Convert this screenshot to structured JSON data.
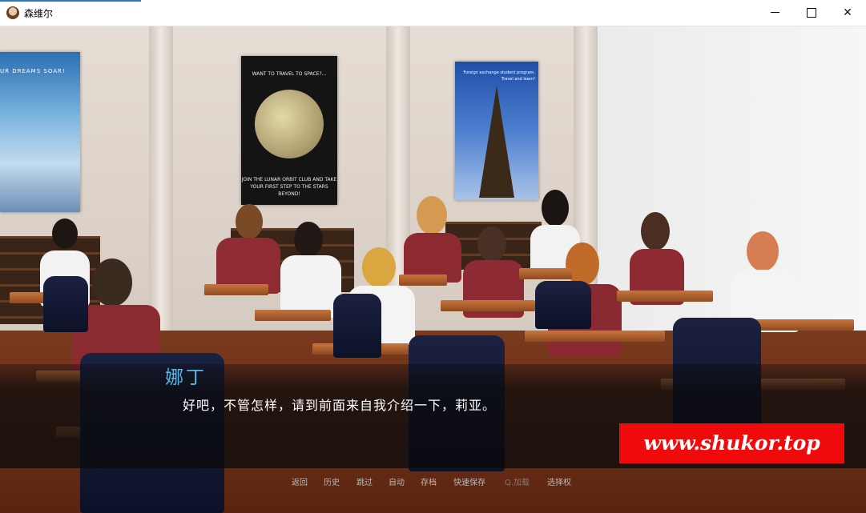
{
  "window": {
    "title": "森维尔",
    "icon": "portrait-icon",
    "controls": {
      "minimize": "minimize-icon",
      "maximize": "maximize-icon",
      "close": "✕"
    }
  },
  "scene": {
    "posters": [
      {
        "text": "UR DREAMS SOAR!"
      },
      {
        "top_text": "WANT TO TRAVEL TO SPACE?...",
        "bottom_text": "JOIN THE LUNAR ORBIT CLUB AND TAKE YOUR FIRST STEP TO THE STARS BEYOND!"
      },
      {
        "text": "Foreign exchange student program. Travel and learn!"
      }
    ]
  },
  "dialogue": {
    "speaker": "娜丁",
    "text": "好吧，不管怎样，请到前面来自我介绍一下，莉亚。"
  },
  "watermark": "www.shukor.top",
  "quick_menu": [
    {
      "label": "返回",
      "enabled": true
    },
    {
      "label": "历史",
      "enabled": true
    },
    {
      "label": "跳过",
      "enabled": true
    },
    {
      "label": "自动",
      "enabled": true
    },
    {
      "label": "存档",
      "enabled": true
    },
    {
      "label": "快速保存",
      "enabled": true
    },
    {
      "label": "Q.加载",
      "enabled": false
    },
    {
      "label": "选择权",
      "enabled": true
    }
  ],
  "colors": {
    "speaker": "#56b9e6",
    "watermark_bg": "#ef0b0b",
    "title_accent": "#2b78c6"
  }
}
